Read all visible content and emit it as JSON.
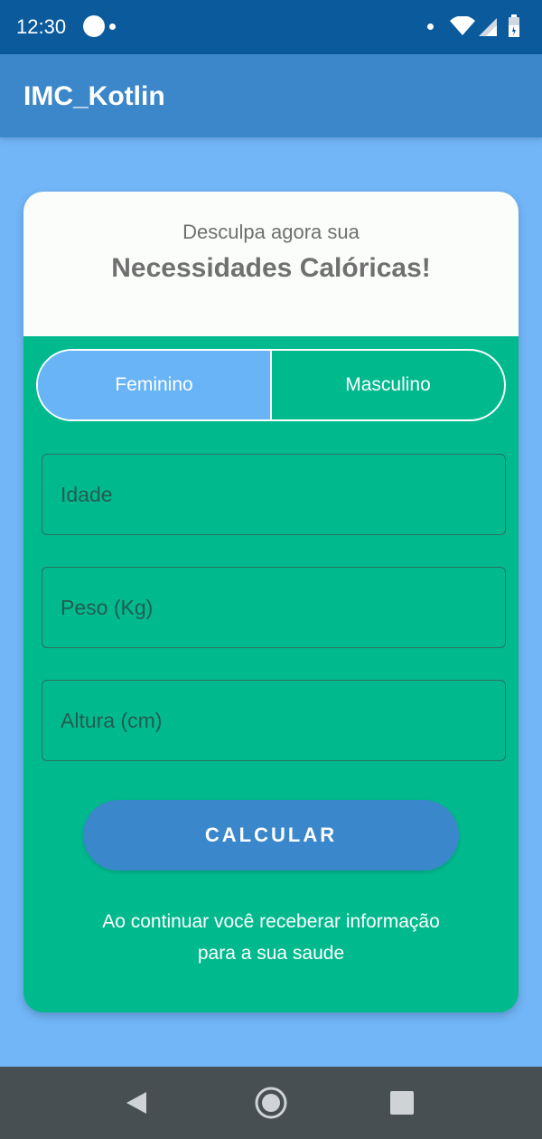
{
  "status_bar": {
    "time": "12:30"
  },
  "app_bar": {
    "title": "IMC_Kotlin"
  },
  "header": {
    "subtitle": "Desculpa agora sua",
    "headline": "Necessidades Calóricas!"
  },
  "gender_toggle": {
    "options": [
      {
        "label": "Feminino",
        "selected": true
      },
      {
        "label": "Masculino",
        "selected": false
      }
    ]
  },
  "form": {
    "age_placeholder": "Idade",
    "weight_placeholder": "Peso (Kg)",
    "height_placeholder": "Altura (cm)",
    "calculate_label": "CALCULAR"
  },
  "info": {
    "line1": "Ao continuar você receberar informação",
    "line2": "para a sua saude"
  },
  "colors": {
    "status_bar": "#0a5a9c",
    "app_bar": "#3b87ca",
    "background": "#72b6f8",
    "card_green": "#00ba8e",
    "toggle_selected": "#68b4f6",
    "button": "#3a88cb",
    "nav_bar": "#474f53"
  },
  "icons": {
    "status": [
      "notification-dot-icon",
      "wifi-icon",
      "signal-icon",
      "battery-icon"
    ],
    "navigation": [
      "back-icon",
      "home-icon",
      "recents-icon"
    ]
  }
}
